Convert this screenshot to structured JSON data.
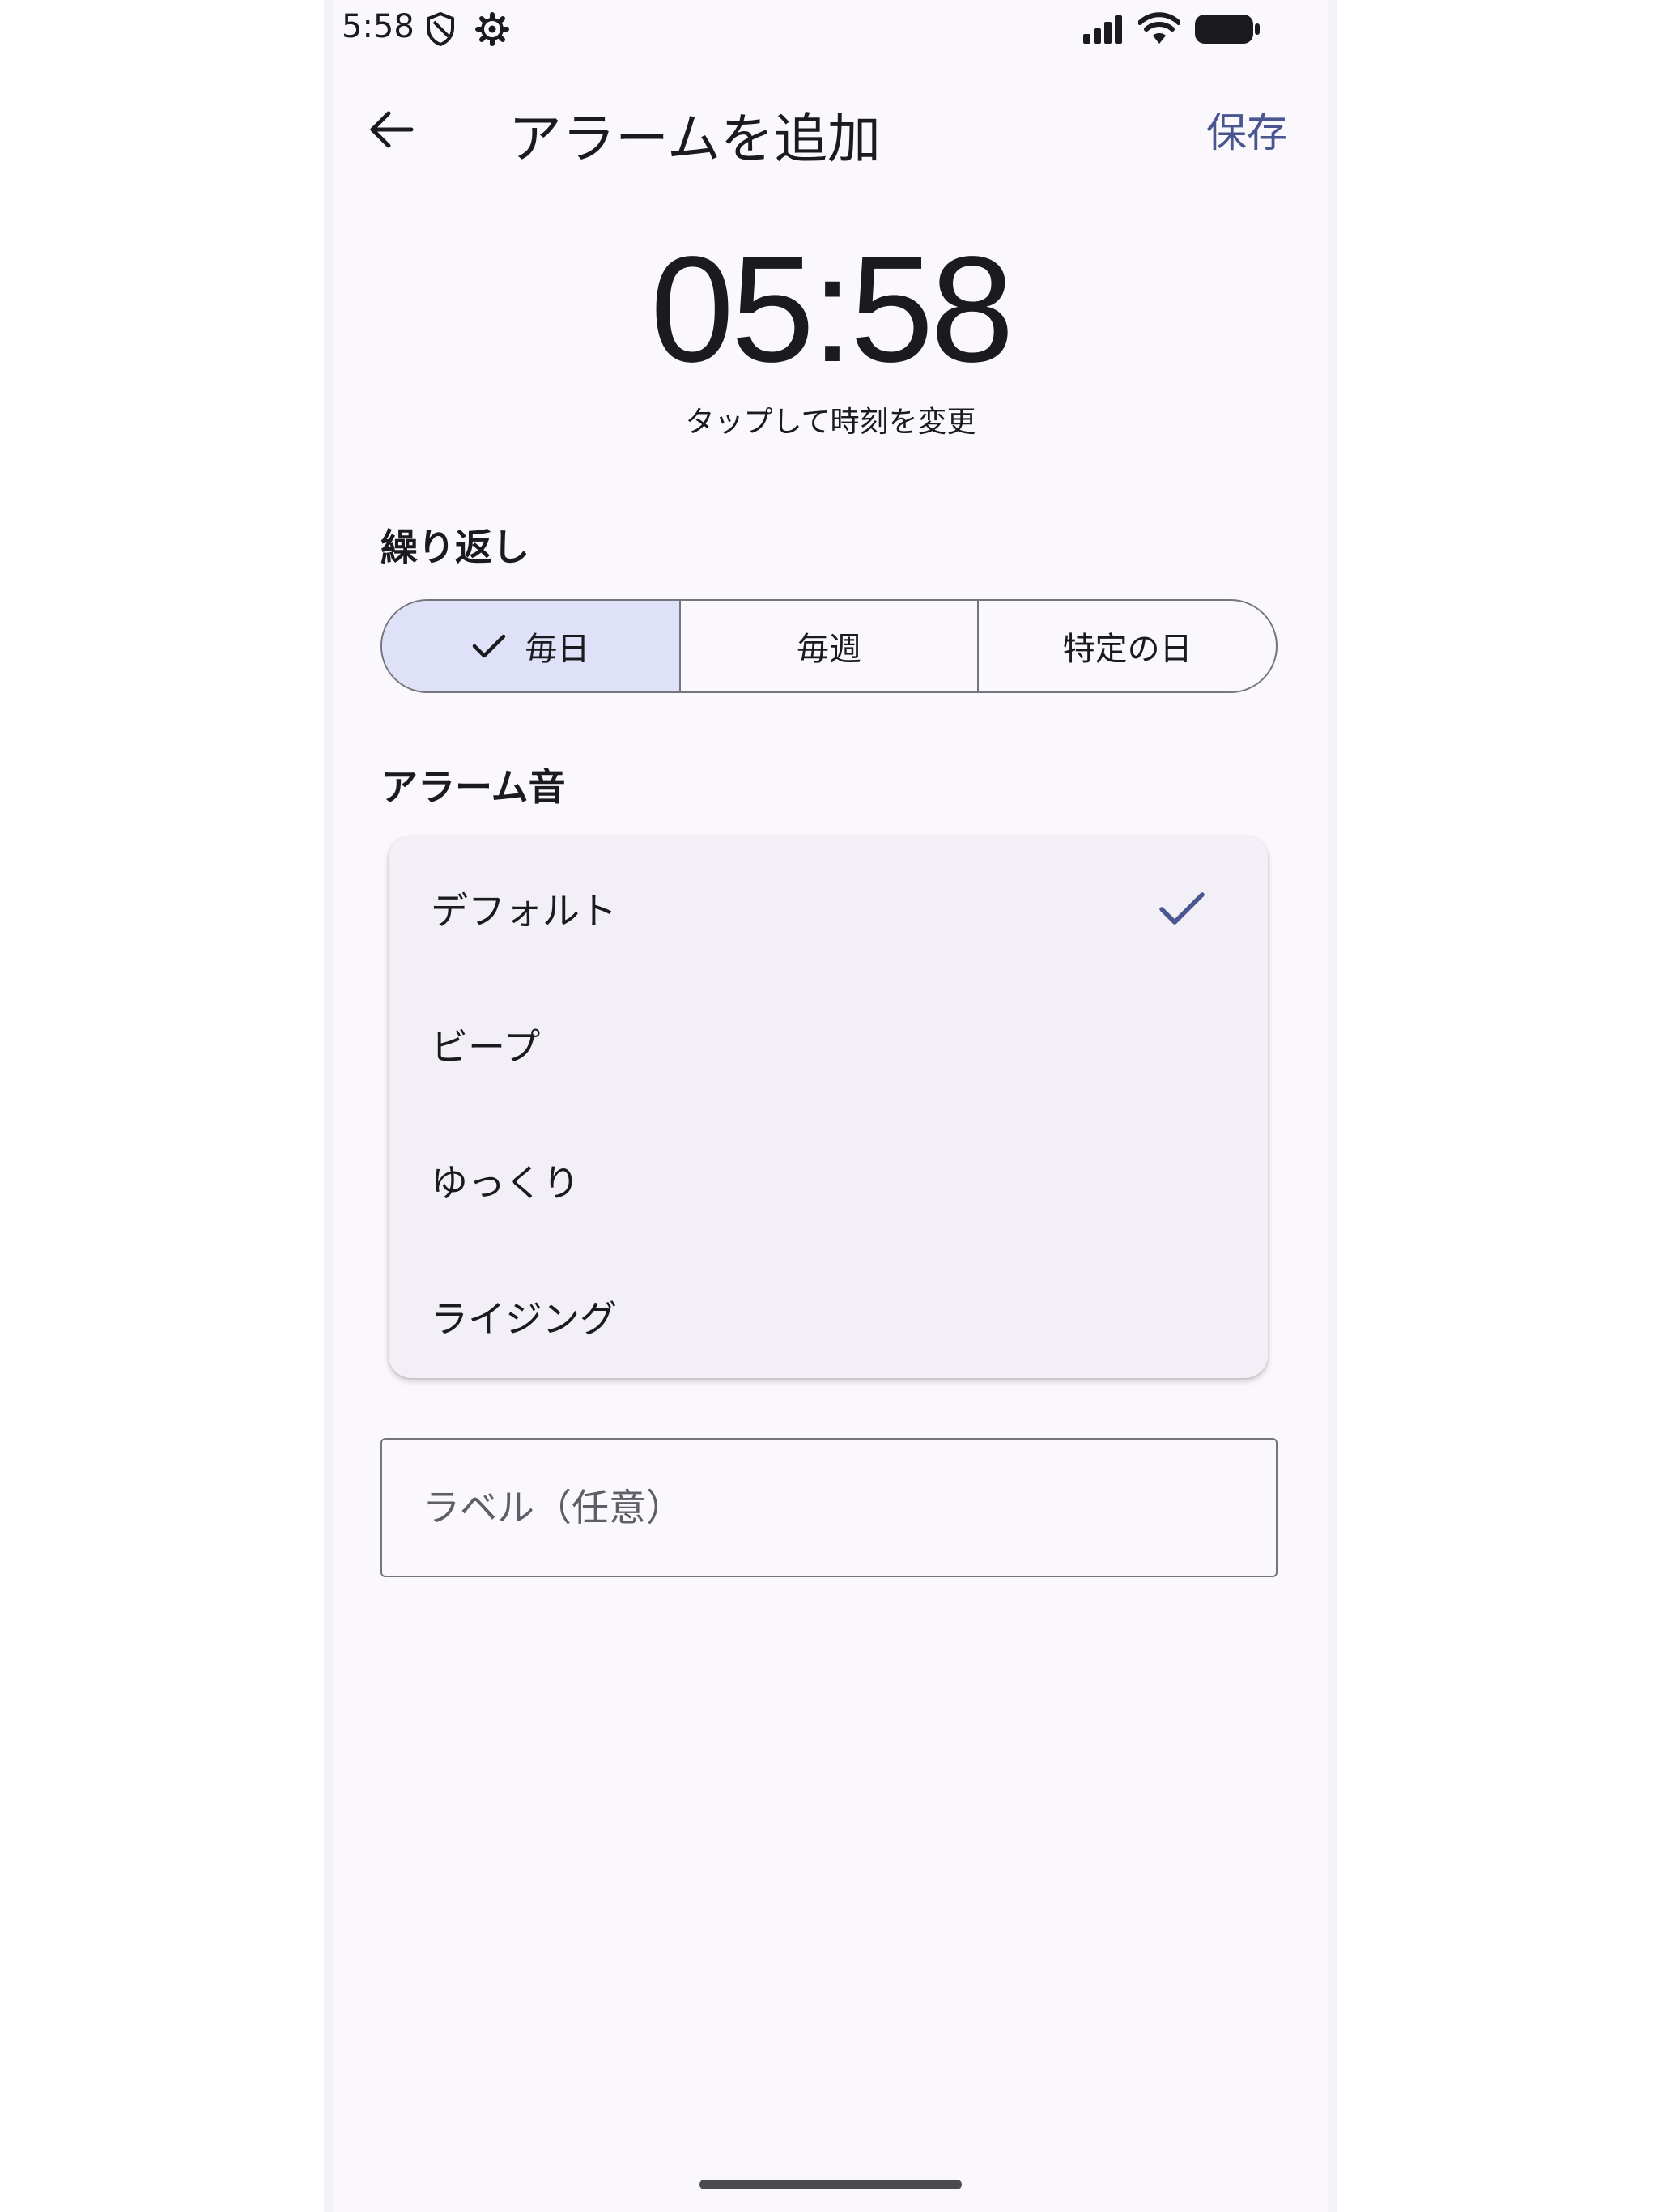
{
  "status_bar": {
    "time": "5:58",
    "icons": [
      "shield-icon",
      "gear-icon",
      "signal-icon",
      "wifi-icon",
      "battery-icon"
    ]
  },
  "app_bar": {
    "title": "アラームを追加",
    "save_label": "保存",
    "back_icon": "arrow-left-icon"
  },
  "time_display": {
    "value": "05:58",
    "hint": "タップして時刻を変更"
  },
  "repeat": {
    "label": "繰り返し",
    "options": [
      "毎日",
      "毎週",
      "特定の日"
    ],
    "selected": "毎日"
  },
  "sound": {
    "label": "アラーム音",
    "options": [
      "デフォルト",
      "ビープ",
      "ゆっくり",
      "ライジング"
    ],
    "selected": "デフォルト"
  },
  "label_input": {
    "placeholder": "ラベル（任意）",
    "value": ""
  },
  "colors": {
    "accent": "#4a5690",
    "selected_segment": "#dfe1f8",
    "background": "#fbf8fd",
    "list_surface": "#f2f0f6"
  }
}
